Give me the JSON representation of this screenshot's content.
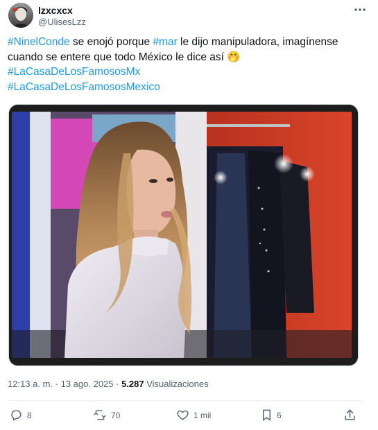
{
  "user": {
    "display_name": "lzxcxcx",
    "handle": "@UlisesLzz"
  },
  "tweet": {
    "lines": [
      [
        {
          "text": "#NinelConde",
          "type": "hashtag"
        },
        {
          "text": " se enojó porque ",
          "type": "text"
        },
        {
          "text": "#mar",
          "type": "hashtag"
        },
        {
          "text": " le dijo manipuladora, imagínense",
          "type": "text"
        }
      ],
      [
        {
          "text": "cuando se entere que todo México le dice así ",
          "type": "text"
        },
        {
          "text": "🤭",
          "type": "emoji"
        }
      ],
      [
        {
          "text": "#LaCasaDeLosFamososMx",
          "type": "hashtag"
        }
      ],
      [
        {
          "text": "#LaCasaDeLosFamososMexico",
          "type": "hashtag"
        }
      ]
    ]
  },
  "meta": {
    "time": "12:13 a. m.",
    "separator": " · ",
    "date": "13 ago. 2025",
    "views_count": "5.287",
    "views_label": " Visualizaciones"
  },
  "actions": {
    "replies": "8",
    "reposts": "70",
    "likes": "1 mil",
    "bookmarks": "6"
  },
  "colors": {
    "accent": "#1d9bf0",
    "text": "#0f1419",
    "secondary": "#536471",
    "divider": "#eff3f4"
  },
  "icons": {
    "more": "more-horizontal-icon",
    "reply": "reply-icon",
    "repost": "repost-icon",
    "like": "heart-icon",
    "bookmark": "bookmark-icon",
    "share": "share-icon"
  }
}
